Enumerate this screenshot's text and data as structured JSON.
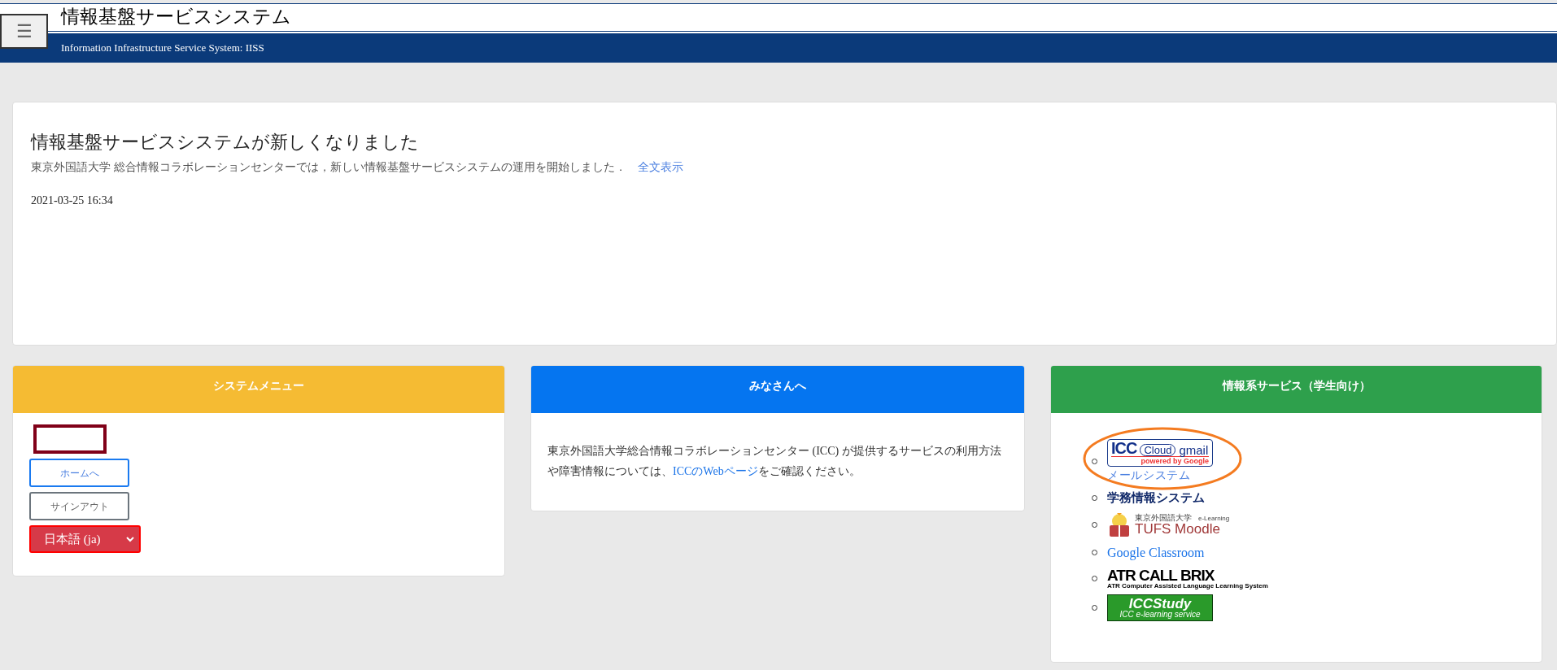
{
  "header": {
    "menu_button": "☰",
    "title": "情報基盤サービスシステム",
    "subtitle": "Information Infrastructure Service System: IISS"
  },
  "notice": {
    "title": "情報基盤サービスシステムが新しくなりました",
    "body": "東京外国語大学 総合情報コラボレーションセンターでは，新しい情報基盤サービスシステムの運用を開始しました．",
    "link": "全文表示",
    "date": "2021-03-25 16:34"
  },
  "system_menu": {
    "title": "システムメニュー",
    "home_button": "ホームへ",
    "signout_button": "サインアウト",
    "language": "日本語 (ja)"
  },
  "for_everyone": {
    "title": "みなさんへ",
    "text_before": "東京外国語大学総合情報コラボレーションセンター (ICC) が提供するサービスの利用方法や障害情報については、",
    "link": "ICCのWebページ",
    "text_after": "をご確認ください。"
  },
  "services": {
    "title": "情報系サービス（学生向け）",
    "items": [
      {
        "kind": "gmail",
        "logo": [
          "ICC",
          "Cloud",
          "gmail",
          "powered by Google"
        ],
        "link": "メールシステム",
        "highlighted": true
      },
      {
        "kind": "heading",
        "text": "学務情報システム"
      },
      {
        "kind": "moodle",
        "small": "東京外国語大学",
        "tag": "e-Learning",
        "name": "TUFS Moodle"
      },
      {
        "kind": "link",
        "text": "Google Classroom"
      },
      {
        "kind": "atr",
        "name": "ATR CALL BRIX",
        "sub": "ATR Computer Assisted Language Learning System"
      },
      {
        "kind": "iccstudy",
        "name": "ICCStudy",
        "sub": "ICC e-learning service"
      }
    ]
  }
}
